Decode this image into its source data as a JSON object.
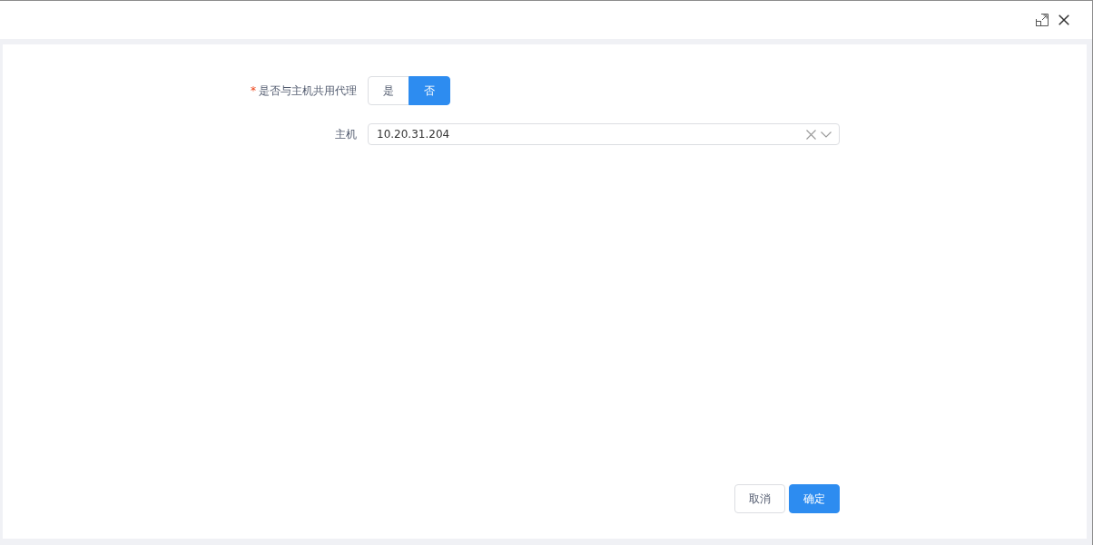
{
  "form": {
    "fields": [
      {
        "kind": "segmented",
        "required_mark": "*",
        "label": "是否与主机共用代理",
        "options": [
          {
            "label": "是",
            "selected": false
          },
          {
            "label": "否",
            "selected": true
          }
        ]
      },
      {
        "kind": "select",
        "label": "主机",
        "value": "10.20.31.204",
        "clearable": true
      }
    ]
  },
  "buttons": [
    {
      "label": "取消",
      "primary": false
    },
    {
      "label": "确定",
      "primary": true
    }
  ]
}
